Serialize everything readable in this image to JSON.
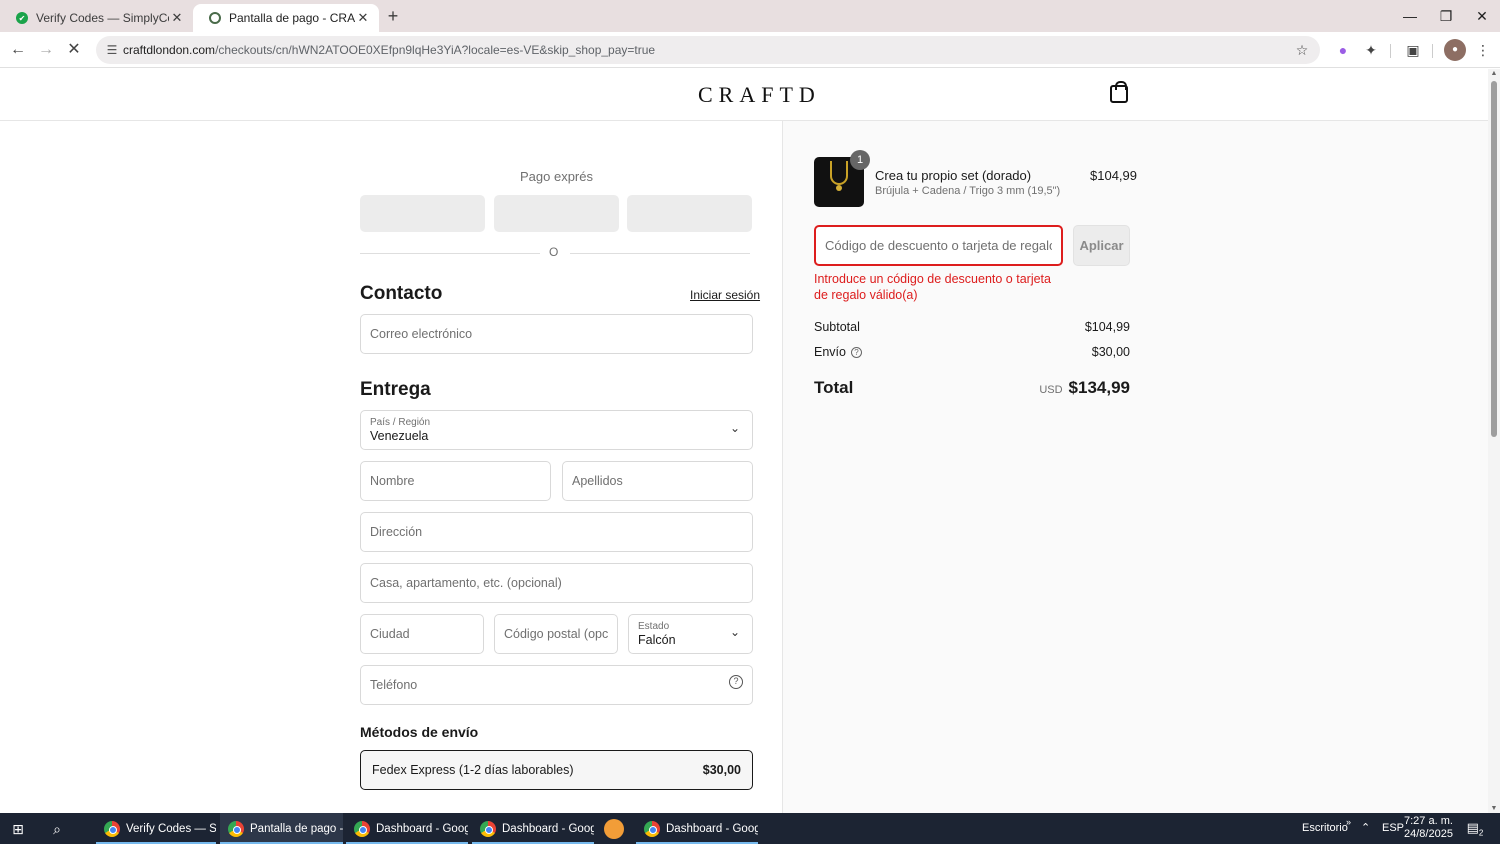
{
  "browser": {
    "tabs": [
      {
        "title": "Verify Codes — SimplyCodes",
        "active": false
      },
      {
        "title": "Pantalla de pago - CRAFTD.com",
        "active": true
      }
    ],
    "url_host": "craftdlondon.com",
    "url_path": "/checkouts/cn/hWN2ATOOE0XEfpn9lqHe3YiA?locale=es-VE&skip_shop_pay=true"
  },
  "site": {
    "logo": "CRAFTD"
  },
  "checkout": {
    "express_title": "Pago exprés",
    "or_label": "O",
    "contact_heading": "Contacto",
    "login_link": "Iniciar sesión",
    "email_placeholder": "Correo electrónico",
    "delivery_heading": "Entrega",
    "country_label": "País / Región",
    "country_value": "Venezuela",
    "first_name_placeholder": "Nombre",
    "last_name_placeholder": "Apellidos",
    "address_placeholder": "Dirección",
    "apartment_placeholder": "Casa, apartamento, etc. (opcional)",
    "city_placeholder": "Ciudad",
    "postal_placeholder": "Código postal (opcional)",
    "state_label": "Estado",
    "state_value": "Falcón",
    "phone_placeholder": "Teléfono",
    "shipping_heading": "Métodos de envío",
    "shipping_option": {
      "label": "Fedex Express (1-2 días laborables)",
      "price": "$30,00"
    }
  },
  "summary": {
    "product": {
      "quantity": "1",
      "name": "Crea tu propio set (dorado)",
      "variant": "Brújula + Cadena / Trigo 3 mm (19,5\")",
      "price": "$104,99"
    },
    "discount_placeholder": "Código de descuento o tarjeta de regalo",
    "apply_label": "Aplicar",
    "error_message": "Introduce un código de descuento o tarjeta de regalo válido(a)",
    "subtotal_label": "Subtotal",
    "subtotal_value": "$104,99",
    "shipping_label": "Envío",
    "shipping_value": "$30,00",
    "total_label": "Total",
    "currency": "USD",
    "total_value": "$134,99"
  },
  "taskbar": {
    "tasks": [
      {
        "label": "Verify Codes — Sim...",
        "active": false
      },
      {
        "label": "Pantalla de pago - ...",
        "active": true
      },
      {
        "label": "Dashboard - Googl...",
        "active": false
      },
      {
        "label": "Dashboard - Googl...",
        "active": false
      },
      {
        "label": "Dashboard - Googl...",
        "active": false
      }
    ],
    "desktop_label": "Escritorio",
    "language": "ESP",
    "time": "7:27 a. m.",
    "date": "24/8/2025",
    "notifications": "2"
  },
  "colors": {
    "error": "#dd1d1d",
    "taskbar": "#1c2433",
    "tabstrip": "#e8dfe0"
  }
}
